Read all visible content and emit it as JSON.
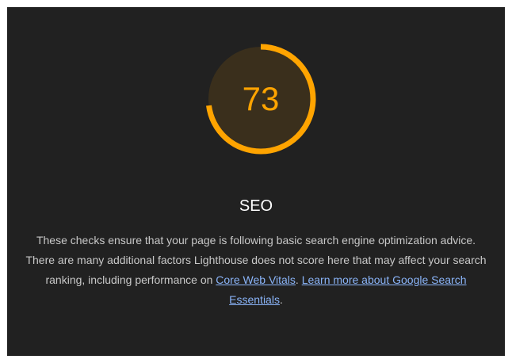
{
  "category": {
    "score": 73,
    "score_label": "73",
    "title": "SEO",
    "description_text": "These checks ensure that your page is following basic search engine optimization advice. There are many additional factors Lighthouse does not score here that may affect your search ranking, including performance on ",
    "link_core_web_vitals": "Core Web Vitals",
    "separator": ". ",
    "link_learn_more": "Learn more about Google Search Essentials",
    "trailing": "."
  },
  "colors": {
    "panel_background": "#212121",
    "gauge_average": "#ffa400",
    "gauge_track": "#3a2f1c",
    "title_text": "#ffffff",
    "body_text": "#c8c8c8",
    "link": "#8ab4f8"
  }
}
